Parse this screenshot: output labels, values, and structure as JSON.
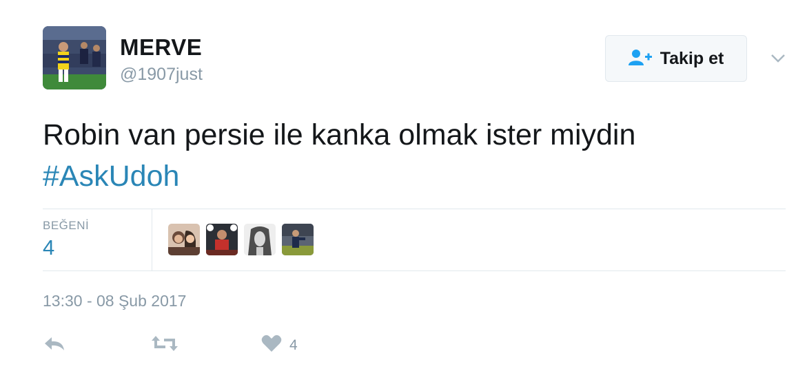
{
  "user": {
    "display_name": "MERVE",
    "handle": "@1907just"
  },
  "follow_button": {
    "label": "Takip et",
    "icon": "add-user-icon"
  },
  "menu": {
    "icon": "chevron-down-icon"
  },
  "tweet": {
    "text": "Robin van persie ile kanka olmak ister miydin",
    "hashtag": "#AskUdoh"
  },
  "stats": {
    "likes_label": "BEĞENİ",
    "likes_value": "4"
  },
  "likers": [
    "avatar-1",
    "avatar-2",
    "avatar-3",
    "avatar-4"
  ],
  "timestamp": "13:30 - 08 Şub 2017",
  "actions": {
    "reply_icon": "reply-icon",
    "retweet_icon": "retweet-icon",
    "like_icon": "heart-icon",
    "like_count": "4"
  },
  "colors": {
    "link": "#2a86b6",
    "muted": "#8899a6",
    "text": "#14171a"
  }
}
